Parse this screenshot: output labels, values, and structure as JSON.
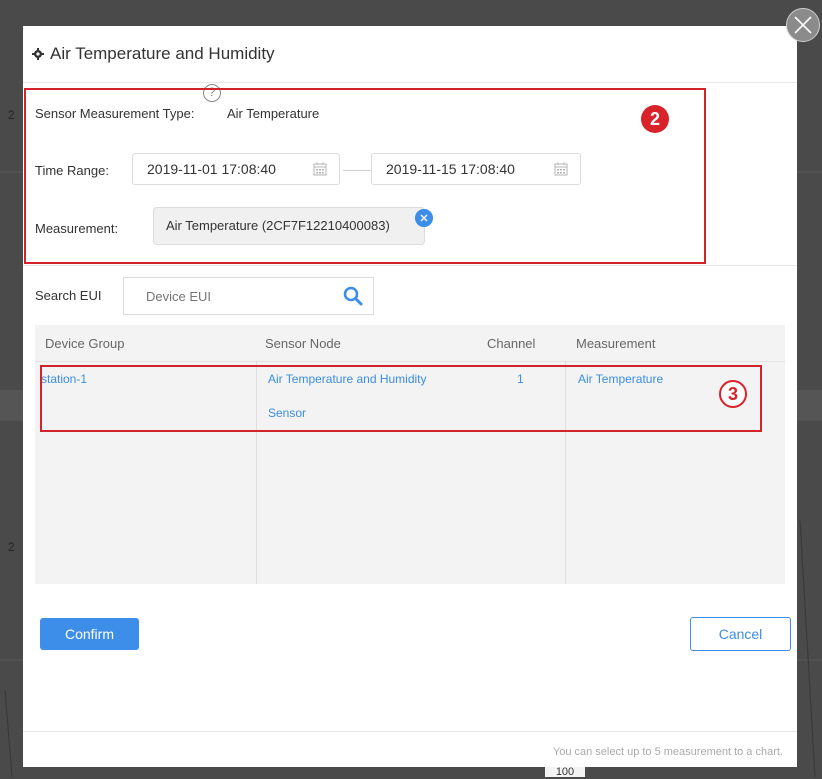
{
  "background": {
    "axis_labels": [
      "2",
      "2"
    ],
    "bottom_label": "100"
  },
  "dialog": {
    "title": "Air Temperature and Humidity",
    "help_glyph": "?",
    "sensor_type_label": "Sensor Measurement Type:",
    "sensor_type_value": "Air Temperature",
    "time_range_label": "Time Range:",
    "start_date": "2019-11-01 17:08:40",
    "end_date": "2019-11-15 17:08:40",
    "measurement_label": "Measurement:",
    "measurement_tag": "Air Temperature (2CF7F12210400083)",
    "annotation_2": "2",
    "annotation_3": "3"
  },
  "search": {
    "label": "Search EUI",
    "placeholder": "Device EUI",
    "value": ""
  },
  "table": {
    "columns": [
      "Device Group",
      "Sensor Node",
      "Channel",
      "Measurement"
    ],
    "rows": [
      {
        "device_group": "station-1",
        "sensor_node_line1": "Air Temperature and Humidity",
        "sensor_node_line2": "Sensor",
        "channel": "1",
        "measurement": "Air Temperature"
      }
    ]
  },
  "buttons": {
    "confirm": "Confirm",
    "cancel": "Cancel"
  },
  "footer": {
    "note": "You can select up to 5 measurement to a chart."
  },
  "colors": {
    "accent": "#3d8ee8",
    "annotation_red": "#d2232a",
    "overlay": "#4a4a4a"
  },
  "icons": [
    "close-icon",
    "gear-icon",
    "help-icon",
    "calendar-icon",
    "search-icon",
    "tag-close-icon"
  ]
}
